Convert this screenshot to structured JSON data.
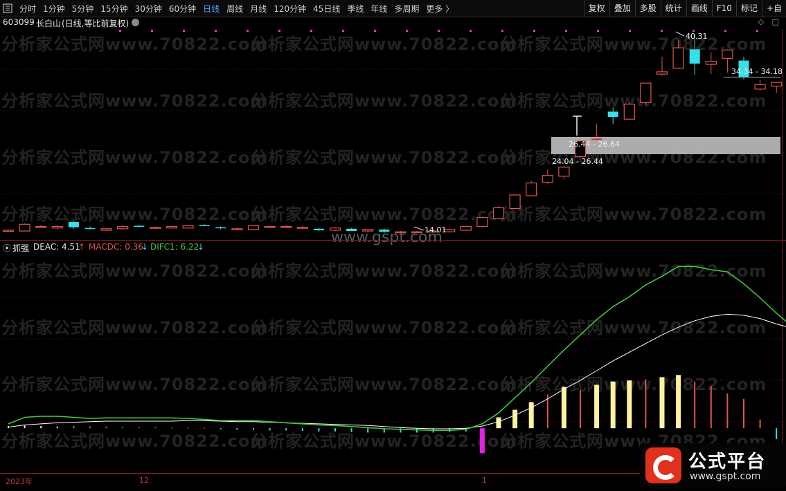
{
  "toolbar": {
    "periods": [
      "分时",
      "1分钟",
      "5分钟",
      "15分钟",
      "30分钟",
      "60分钟",
      "日线",
      "周线",
      "月线",
      "120分钟",
      "45日线",
      "季线",
      "年线",
      "多周期",
      "更多 〉"
    ],
    "active_period": "日线",
    "right_buttons": [
      "复权",
      "叠加",
      "多股",
      "统计",
      "画线",
      "F10",
      "标记",
      "+自"
    ]
  },
  "stock": {
    "code": "603099",
    "name": "长白山",
    "mode": "(日线,等比前复权)",
    "price_labels": {
      "high": "40.31",
      "low": "14.01",
      "zone_upper": "34.34 - 34.18",
      "zone_mid": "26.44 - 26.64",
      "zone_lower": "24.04 - 26.44"
    }
  },
  "indicator": {
    "name": "抓强",
    "deac": "DEAC: 4.51",
    "deac_arrow": "↑",
    "macdc": "MACDC: 0.36",
    "macdc_arrow": "↓",
    "difc1": "DIFC1: 6.22",
    "difc1_arrow": "↓"
  },
  "time_axis": {
    "labels": [
      "2023年",
      "12",
      "1"
    ]
  },
  "watermarks": {
    "text": "分析家公式网www.70822.com",
    "site": "www.gspt.com"
  },
  "logo": {
    "title": "公式平台",
    "url": "www.gspt.com"
  },
  "colors": {
    "up": "#e0554f",
    "down": "#36e0e8",
    "difc": "#3fc83f",
    "deac": "#ffffff",
    "hist_up": "#e0554f",
    "hist_yellow": "#fff2a0",
    "hist_magenta": "#e61fe6",
    "hist_down": "#36e0e8",
    "active_tab": "#41a6ff"
  },
  "chart_data": {
    "type": "candlestick",
    "price_ylim": [
      13.0,
      41.0
    ],
    "candles": [
      {
        "o": 14.2,
        "h": 14.3,
        "l": 14.1,
        "c": 14.2
      },
      {
        "o": 14.1,
        "h": 15.1,
        "l": 14.1,
        "c": 15.0
      },
      {
        "o": 14.6,
        "h": 14.9,
        "l": 14.5,
        "c": 14.7
      },
      {
        "o": 14.5,
        "h": 14.9,
        "l": 14.3,
        "c": 14.7
      },
      {
        "o": 15.3,
        "h": 15.4,
        "l": 14.4,
        "c": 14.6
      },
      {
        "o": 14.5,
        "h": 14.7,
        "l": 14.3,
        "c": 14.4
      },
      {
        "o": 14.2,
        "h": 14.3,
        "l": 14.1,
        "c": 14.4
      },
      {
        "o": 14.4,
        "h": 14.9,
        "l": 14.3,
        "c": 14.7
      },
      {
        "o": 14.8,
        "h": 14.9,
        "l": 14.6,
        "c": 14.7
      },
      {
        "o": 14.5,
        "h": 14.7,
        "l": 14.4,
        "c": 14.6
      },
      {
        "o": 14.5,
        "h": 14.8,
        "l": 14.4,
        "c": 14.7
      },
      {
        "o": 14.5,
        "h": 14.8,
        "l": 14.4,
        "c": 14.8
      },
      {
        "o": 14.9,
        "h": 15.0,
        "l": 14.8,
        "c": 14.8
      },
      {
        "o": 14.6,
        "h": 14.7,
        "l": 14.3,
        "c": 14.5
      },
      {
        "o": 14.4,
        "h": 14.6,
        "l": 14.3,
        "c": 14.4
      },
      {
        "o": 14.3,
        "h": 14.8,
        "l": 14.2,
        "c": 14.8
      },
      {
        "o": 14.7,
        "h": 14.8,
        "l": 14.6,
        "c": 14.7
      },
      {
        "o": 14.6,
        "h": 14.9,
        "l": 14.5,
        "c": 14.7
      },
      {
        "o": 14.6,
        "h": 14.8,
        "l": 14.4,
        "c": 14.6
      },
      {
        "o": 14.4,
        "h": 14.5,
        "l": 14.1,
        "c": 14.2
      },
      {
        "o": 14.2,
        "h": 14.6,
        "l": 14.1,
        "c": 14.5
      },
      {
        "o": 14.4,
        "h": 14.5,
        "l": 14.1,
        "c": 14.1
      },
      {
        "o": 14.1,
        "h": 14.3,
        "l": 13.9,
        "c": 14.3
      },
      {
        "o": 14.3,
        "h": 14.4,
        "l": 13.8,
        "c": 14.0
      },
      {
        "o": 14.0,
        "h": 14.1,
        "l": 13.9,
        "c": 14.0
      },
      {
        "o": 14.0,
        "h": 14.1,
        "l": 13.9,
        "c": 14.0
      },
      {
        "o": 14.0,
        "h": 14.1,
        "l": 13.9,
        "c": 14.1
      },
      {
        "o": 14.0,
        "h": 14.4,
        "l": 13.9,
        "c": 14.3
      },
      {
        "o": 14.2,
        "h": 14.8,
        "l": 14.1,
        "c": 14.7
      },
      {
        "o": 14.7,
        "h": 16.0,
        "l": 14.6,
        "c": 15.9
      },
      {
        "o": 15.8,
        "h": 17.4,
        "l": 15.7,
        "c": 17.2
      },
      {
        "o": 17.1,
        "h": 19.0,
        "l": 17.0,
        "c": 18.9
      },
      {
        "o": 18.8,
        "h": 20.8,
        "l": 18.7,
        "c": 20.5
      },
      {
        "o": 20.6,
        "h": 22.3,
        "l": 20.4,
        "c": 21.5
      },
      {
        "o": 21.4,
        "h": 22.8,
        "l": 21.0,
        "c": 22.6
      },
      {
        "o": 24.0,
        "h": 26.2,
        "l": 23.9,
        "c": 26.1
      },
      {
        "o": 26.4,
        "h": 28.4,
        "l": 26.3,
        "c": 26.4
      },
      {
        "o": 30.0,
        "h": 30.6,
        "l": 28.3,
        "c": 29.3
      },
      {
        "o": 29.0,
        "h": 31.2,
        "l": 28.9,
        "c": 31.0
      },
      {
        "o": 31.2,
        "h": 33.4,
        "l": 30.9,
        "c": 33.8
      },
      {
        "o": 35.0,
        "h": 37.3,
        "l": 34.8,
        "c": 35.3
      },
      {
        "o": 35.8,
        "h": 39.5,
        "l": 35.7,
        "c": 38.5
      },
      {
        "o": 38.3,
        "h": 40.3,
        "l": 34.9,
        "c": 36.4
      },
      {
        "o": 36.3,
        "h": 37.9,
        "l": 35.0,
        "c": 36.7
      },
      {
        "o": 37.1,
        "h": 38.3,
        "l": 35.2,
        "c": 38.2
      },
      {
        "o": 36.8,
        "h": 37.3,
        "l": 34.3,
        "c": 34.6
      },
      {
        "o": 33.0,
        "h": 34.2,
        "l": 32.8,
        "c": 33.6
      },
      {
        "o": 33.4,
        "h": 34.0,
        "l": 32.5,
        "c": 33.9
      },
      {
        "o": 33.6,
        "h": 33.9,
        "l": 31.8,
        "c": 32.3
      }
    ],
    "indicator_ylim": [
      -4.0,
      16.0
    ],
    "difc1": [
      0.4,
      1.0,
      1.1,
      1.1,
      1.0,
      0.9,
      0.95,
      0.95,
      0.95,
      0.95,
      0.95,
      0.9,
      0.8,
      0.7,
      0.7,
      0.7,
      0.6,
      0.5,
      0.4,
      0.3,
      0.25,
      0.15,
      0.05,
      -0.05,
      -0.1,
      -0.15,
      -0.2,
      -0.2,
      -0.1,
      0.4,
      1.4,
      2.8,
      4.2,
      5.7,
      7.2,
      8.6,
      10.0,
      11.2,
      12.1,
      13.2,
      14.0,
      14.9,
      14.9,
      14.6,
      14.4,
      13.3,
      12.0,
      10.6,
      9.3
    ],
    "deac": [
      0.1,
      0.3,
      0.4,
      0.5,
      0.55,
      0.6,
      0.65,
      0.65,
      0.65,
      0.65,
      0.65,
      0.7,
      0.7,
      0.65,
      0.6,
      0.6,
      0.55,
      0.5,
      0.45,
      0.4,
      0.35,
      0.3,
      0.25,
      0.15,
      0.05,
      0.0,
      -0.05,
      -0.05,
      0.0,
      0.2,
      0.6,
      1.2,
      1.9,
      2.7,
      3.6,
      4.4,
      5.3,
      6.2,
      7.0,
      7.8,
      8.6,
      9.3,
      9.9,
      10.3,
      10.5,
      10.4,
      10.1,
      9.6,
      9.2
    ],
    "macdc": [
      {
        "v": 0.2,
        "c": "yellow"
      },
      {
        "v": 0.25,
        "c": "yellow"
      },
      {
        "v": 0.2,
        "c": "yellow"
      },
      {
        "v": 0.15,
        "c": "yellow"
      },
      {
        "v": 0.2,
        "c": "up"
      },
      {
        "v": 0.15,
        "c": "up"
      },
      {
        "v": 0.15,
        "c": "up"
      },
      {
        "v": 0.1,
        "c": "up"
      },
      {
        "v": 0.1,
        "c": "up"
      },
      {
        "v": 0.1,
        "c": "up"
      },
      {
        "v": 0.05,
        "c": "up"
      },
      {
        "v": 0.05,
        "c": "up"
      },
      {
        "v": 0.05,
        "c": "up"
      },
      {
        "v": -0.1,
        "c": "down"
      },
      {
        "v": -0.15,
        "c": "down"
      },
      {
        "v": -0.15,
        "c": "down"
      },
      {
        "v": -0.2,
        "c": "down"
      },
      {
        "v": -0.2,
        "c": "down"
      },
      {
        "v": -0.25,
        "c": "down"
      },
      {
        "v": -0.3,
        "c": "down"
      },
      {
        "v": -0.3,
        "c": "down"
      },
      {
        "v": -0.35,
        "c": "down"
      },
      {
        "v": -0.4,
        "c": "down"
      },
      {
        "v": -0.4,
        "c": "down"
      },
      {
        "v": -0.4,
        "c": "down"
      },
      {
        "v": -0.4,
        "c": "down"
      },
      {
        "v": -0.4,
        "c": "down"
      },
      {
        "v": -0.35,
        "c": "down"
      },
      {
        "v": -0.3,
        "c": "down"
      },
      {
        "v": -2.3,
        "c": "magenta"
      },
      {
        "v": 1.0,
        "c": "yellow"
      },
      {
        "v": 1.7,
        "c": "yellow"
      },
      {
        "v": 2.4,
        "c": "yellow"
      },
      {
        "v": 3.1,
        "c": "up"
      },
      {
        "v": 3.8,
        "c": "yellow"
      },
      {
        "v": 3.5,
        "c": "up"
      },
      {
        "v": 4.0,
        "c": "yellow"
      },
      {
        "v": 4.3,
        "c": "yellow"
      },
      {
        "v": 4.4,
        "c": "yellow"
      },
      {
        "v": 4.5,
        "c": "up"
      },
      {
        "v": 4.7,
        "c": "yellow"
      },
      {
        "v": 4.9,
        "c": "yellow"
      },
      {
        "v": 4.3,
        "c": "up"
      },
      {
        "v": 3.9,
        "c": "up"
      },
      {
        "v": 3.2,
        "c": "up"
      },
      {
        "v": 2.7,
        "c": "up"
      },
      {
        "v": 0.8,
        "c": "up"
      },
      {
        "v": -1.0,
        "c": "down"
      },
      {
        "v": -1.1,
        "c": "down"
      }
    ]
  }
}
